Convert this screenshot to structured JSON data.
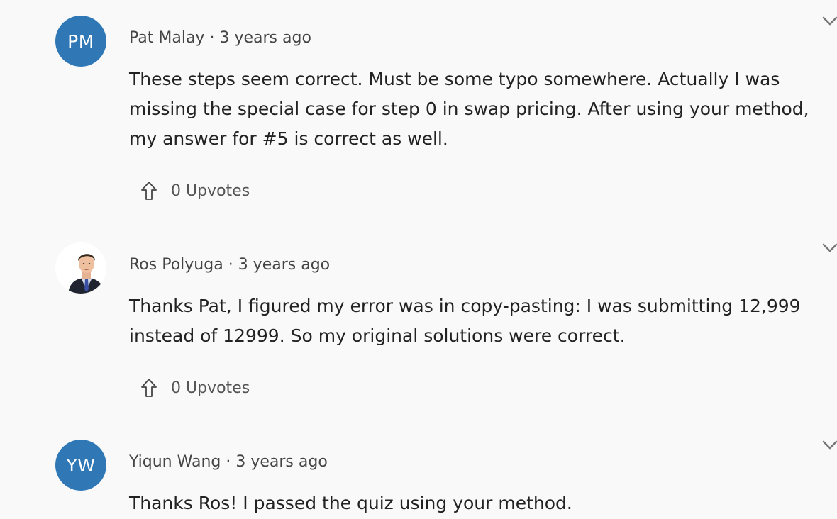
{
  "comments": [
    {
      "avatar_initials": "PM",
      "avatar_color": "#2f77b5",
      "author": "Pat Malay",
      "separator": "·",
      "time": "3 years ago",
      "text": "These steps seem correct. Must be some typo somewhere. Actually I was missing the special case for step 0 in swap pricing. After using your method, my answer for #5 is correct as well.",
      "upvotes_label": "0 Upvotes"
    },
    {
      "avatar_initials": "",
      "avatar_icon": "profile-photo",
      "author": "Ros Polyuga",
      "separator": "·",
      "time": "3 years ago",
      "text": "Thanks Pat, I figured my error was in copy-pasting: I was submitting 12,999 instead of 12999. So my original solutions were correct.",
      "upvotes_label": "0 Upvotes"
    },
    {
      "avatar_initials": "YW",
      "avatar_color": "#2f77b5",
      "author": "Yiqun Wang",
      "separator": "·",
      "time": "3 years ago",
      "text": "Thanks Ros! I passed the quiz using your method.",
      "upvotes_label": ""
    }
  ],
  "icons": {
    "upvote": "arrow-up-outline-icon",
    "expand": "chevron-down-icon"
  }
}
